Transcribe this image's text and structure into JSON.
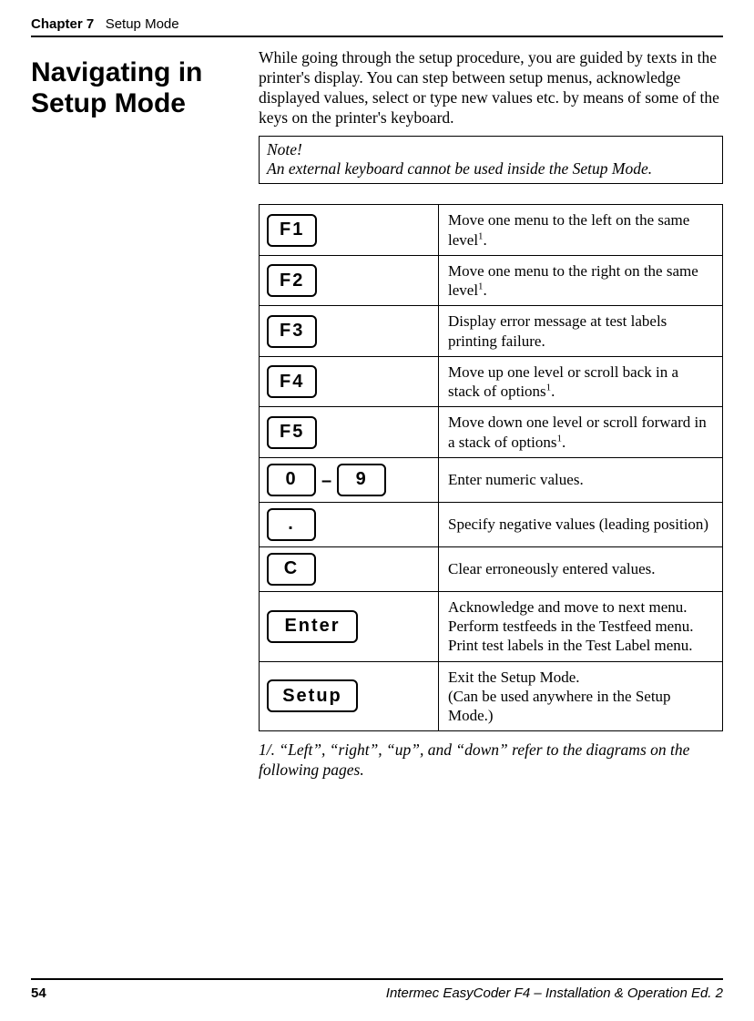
{
  "running_head": {
    "chapter": "Chapter 7",
    "title": "Setup Mode"
  },
  "heading": "Navigating in Setup Mode",
  "intro": "While going through the setup procedure, you are guided by texts in the printer's display. You can step between setup menus, acknowledge displayed values, select or type new values etc. by means of some of the keys on the printer's keyboard.",
  "note": {
    "title": "Note!",
    "text": "An external keyboard cannot be used inside the Setup Mode."
  },
  "rows": [
    {
      "key": "F1",
      "desc_pre": "Move one menu to the left on the same level",
      "desc_sup": "1",
      "desc_post": "."
    },
    {
      "key": "F2",
      "desc_pre": "Move one menu to the right on the same level",
      "desc_sup": "1",
      "desc_post": "."
    },
    {
      "key": "F3",
      "desc": "Display error message at test labels printing failure."
    },
    {
      "key": "F4",
      "desc_pre": "Move up one level or scroll back in a stack of options",
      "desc_sup": "1",
      "desc_post": "."
    },
    {
      "key": "F5",
      "desc_pre": "Move down one level or scroll forward in a stack of options",
      "desc_sup": "1",
      "desc_post": "."
    },
    {
      "key_from": "0",
      "key_sep": "–",
      "key_to": "9",
      "desc": "Enter numeric values."
    },
    {
      "key": ".",
      "desc": "Specify negative values (leading position)"
    },
    {
      "key": "C",
      "desc": "Clear erroneously entered values."
    },
    {
      "key": "Enter",
      "wide": true,
      "desc_lines": [
        "Acknowledge and move to next menu.",
        "Perform testfeeds in the Testfeed menu.",
        "Print test labels in the Test Label menu."
      ]
    },
    {
      "key": "Setup",
      "wide": true,
      "desc_lines": [
        "Exit the Setup Mode.",
        "(Can be used anywhere in the Setup Mode.)"
      ]
    }
  ],
  "footnote": "1/. “Left”, “right”, “up”, and “down” refer to the diagrams on the following pages.",
  "footer": {
    "page": "54",
    "book": "Intermec EasyCoder F4 – Installation & Operation Ed. 2"
  }
}
